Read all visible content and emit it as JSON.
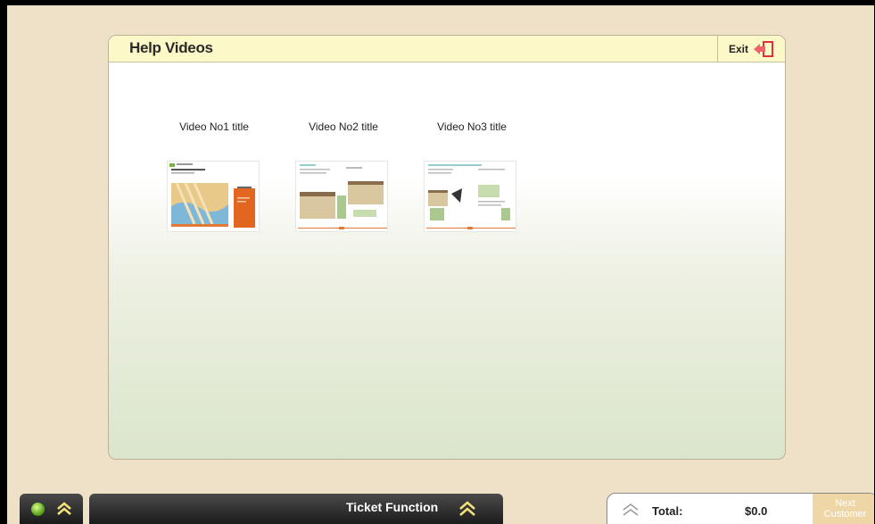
{
  "dialog": {
    "title": "Help Videos",
    "exit_label": "Exit",
    "exit_icon": "exit-door-icon"
  },
  "videos": [
    {
      "title": "Video No1 title",
      "thumbnail": "video-thumbnail-1"
    },
    {
      "title": "Video No2 title",
      "thumbnail": "video-thumbnail-2"
    },
    {
      "title": "Video No3 title",
      "thumbnail": "video-thumbnail-3"
    }
  ],
  "bottom_bar": {
    "status_icon": "status-green-icon",
    "expand_icon": "double-chevron-up-icon",
    "ticket_function_label": "Ticket Function",
    "total_label": "Total:",
    "total_value": "$0.0",
    "next_customer_line1": "Next",
    "next_customer_line2": "Customer"
  },
  "colors": {
    "background": "#efe1c8",
    "header": "#fdf8c8",
    "accent_red": "#e0313a",
    "chevron_yellow": "#f4e27a",
    "next_button": "#efd6a6"
  }
}
